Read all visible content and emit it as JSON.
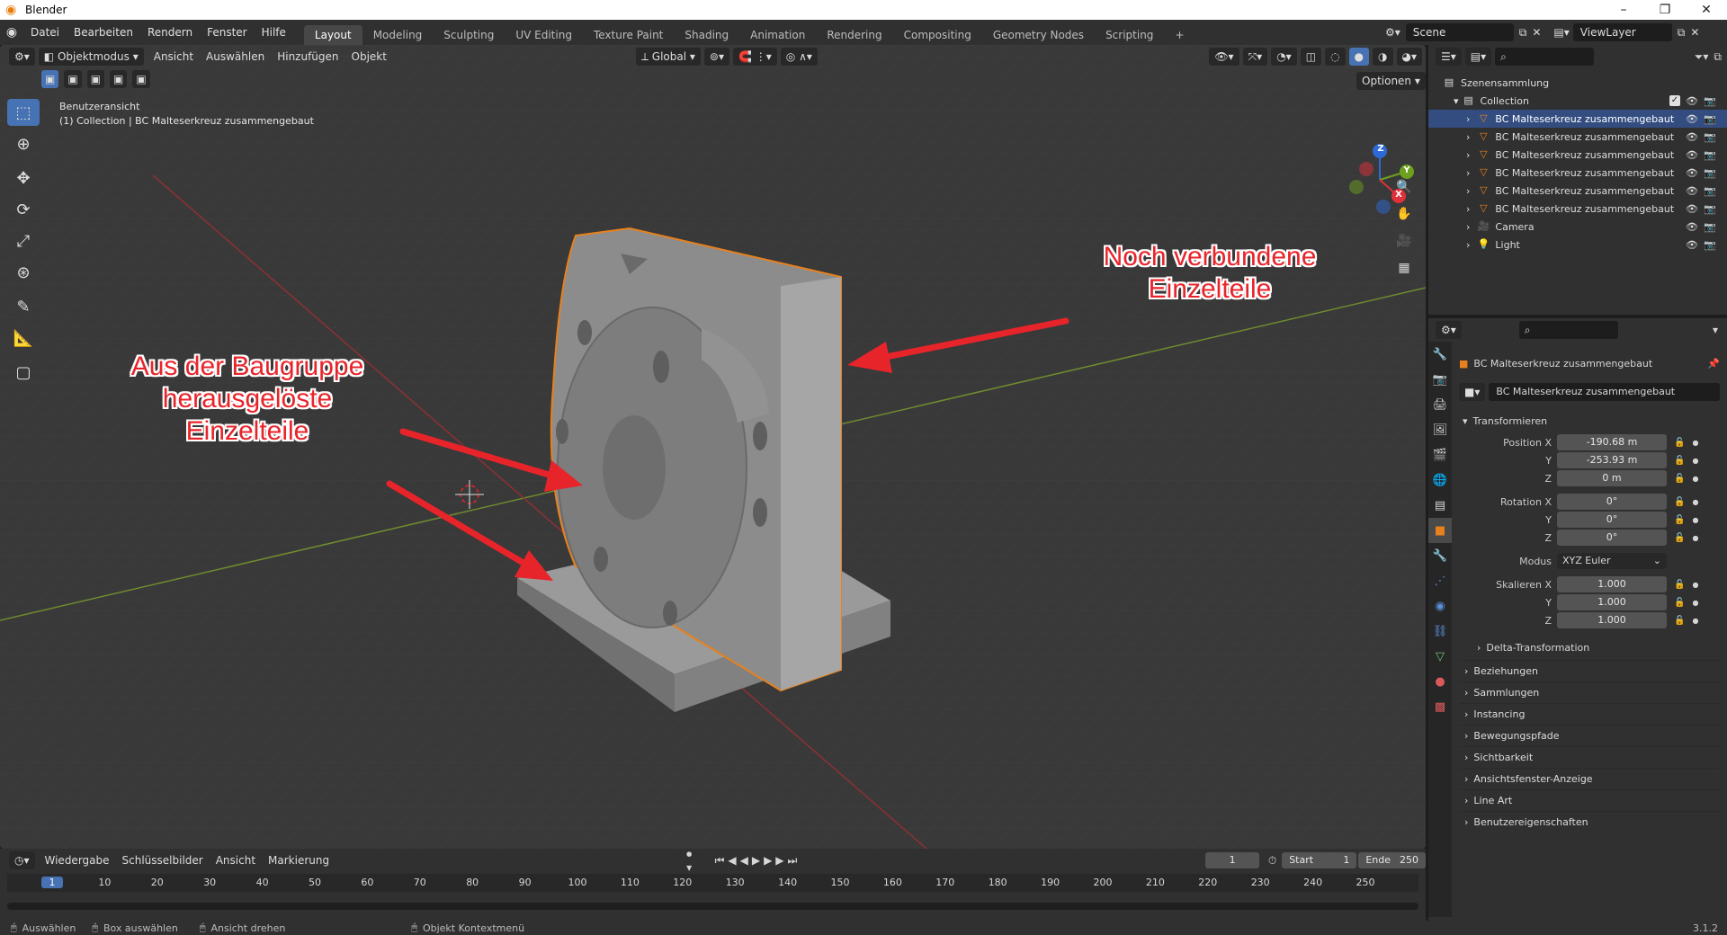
{
  "title_bar": {
    "app_title": "Blender",
    "minimize": "–",
    "maximize": "❐",
    "close": "✕"
  },
  "menu": [
    "Datei",
    "Bearbeiten",
    "Rendern",
    "Fenster",
    "Hilfe"
  ],
  "workspaces": [
    "Layout",
    "Modeling",
    "Sculpting",
    "UV Editing",
    "Texture Paint",
    "Shading",
    "Animation",
    "Rendering",
    "Compositing",
    "Geometry Nodes",
    "Scripting",
    "+"
  ],
  "active_workspace": "Layout",
  "scene": {
    "name": "Scene",
    "view_layer": "ViewLayer"
  },
  "viewport_header": {
    "mode": "Objektmodus",
    "menus": [
      "Ansicht",
      "Auswählen",
      "Hinzufügen",
      "Objekt"
    ],
    "transform_orientation": "Global",
    "options": "Optionen"
  },
  "viewport_info": {
    "view_name": "Benutzeransicht",
    "context": "(1) Collection | BC Malteserkreuz zusammengebaut"
  },
  "gizmo_axes": {
    "z": "Z",
    "y": "Y",
    "x": "X"
  },
  "annotations": {
    "right_line1": "Noch verbundene",
    "right_line2": "Einzelteile",
    "left_line1": "Aus der Baugruppe",
    "left_line2": "herausgelöste",
    "left_line3": "Einzelteile"
  },
  "outliner": {
    "root": "Szenensammlung",
    "collection": "Collection",
    "items": [
      {
        "name": "BC Malteserkreuz zusammengebaut",
        "type": "mesh",
        "selected": true
      },
      {
        "name": "BC Malteserkreuz zusammengebaut",
        "type": "mesh",
        "selected": false
      },
      {
        "name": "BC Malteserkreuz zusammengebaut",
        "type": "mesh",
        "selected": false
      },
      {
        "name": "BC Malteserkreuz zusammengebaut",
        "type": "mesh",
        "selected": false
      },
      {
        "name": "BC Malteserkreuz zusammengebaut",
        "type": "mesh",
        "selected": false
      },
      {
        "name": "BC Malteserkreuz zusammengebaut",
        "type": "mesh",
        "selected": false
      },
      {
        "name": "Camera",
        "type": "camera",
        "selected": false
      },
      {
        "name": "Light",
        "type": "light",
        "selected": false
      }
    ]
  },
  "properties": {
    "object_title": "BC Malteserkreuz zusammengebaut",
    "object_name_field": "BC Malteserkreuz zusammengebaut",
    "transform_panel": "Transformieren",
    "position_label": "Position X",
    "position": {
      "x": "-190.68 m",
      "y": "-253.93 m",
      "z": "0 m"
    },
    "rotation_label": "Rotation X",
    "rotation": {
      "x": "0°",
      "y": "0°",
      "z": "0°"
    },
    "mode_label": "Modus",
    "mode_value": "XYZ Euler",
    "scale_label": "Skalieren X",
    "scale": {
      "x": "1.000",
      "y": "1.000",
      "z": "1.000"
    },
    "axis_y": "Y",
    "axis_z": "Z",
    "delta": "Delta-Transformation",
    "panels": [
      "Beziehungen",
      "Sammlungen",
      "Instancing",
      "Bewegungspfade",
      "Sichtbarkeit",
      "Ansichtsfenster-Anzeige",
      "Line Art",
      "Benutzereigenschaften"
    ]
  },
  "timeline": {
    "menus": [
      "Wiedergabe",
      "Schlüsselbilder",
      "Ansicht",
      "Markierung"
    ],
    "current_frame": "1",
    "start_label": "Start",
    "start": "1",
    "end_label": "Ende",
    "end": "250",
    "ruler": [
      "1",
      "10",
      "20",
      "30",
      "40",
      "50",
      "60",
      "70",
      "80",
      "90",
      "100",
      "110",
      "120",
      "130",
      "140",
      "150",
      "160",
      "170",
      "180",
      "190",
      "200",
      "210",
      "220",
      "230",
      "240",
      "250"
    ]
  },
  "statusbar": {
    "select": "Auswählen",
    "box_select": "Box auswählen",
    "rotate_view": "Ansicht drehen",
    "context_menu": "Objekt Kontextmenü",
    "version": "3.1.2"
  },
  "colors": {
    "accent": "#4772b3",
    "selection_outline": "#e8811c",
    "annotation": "#e8242b"
  }
}
